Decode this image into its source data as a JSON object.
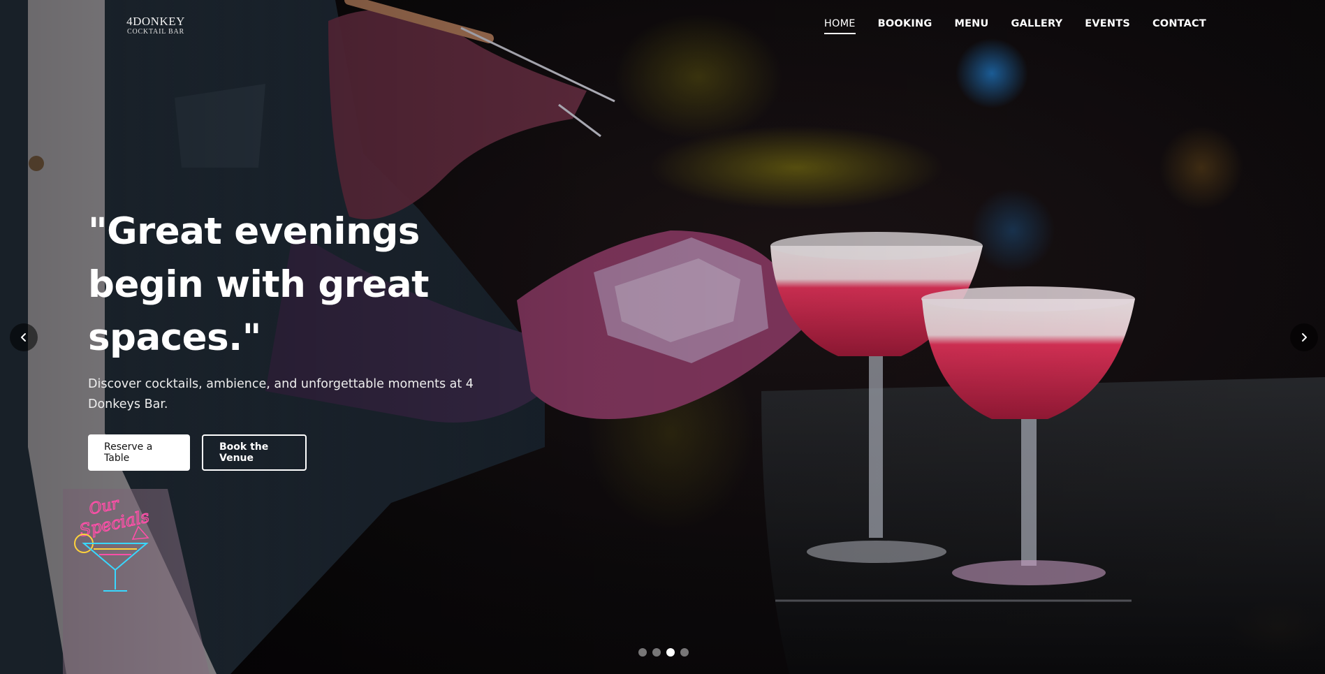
{
  "brand": {
    "name": "4DONKEY",
    "tagline": "COCKTAIL BAR"
  },
  "nav": {
    "items": [
      {
        "label": "HOME",
        "active": true
      },
      {
        "label": "BOOKING",
        "active": false
      },
      {
        "label": "MENU",
        "active": false
      },
      {
        "label": "GALLERY",
        "active": false
      },
      {
        "label": "EVENTS",
        "active": false
      },
      {
        "label": "CONTACT",
        "active": false
      }
    ]
  },
  "hero": {
    "headline": "\"Great evenings begin with great spaces.\"",
    "subtext": "Discover cocktails, ambience, and unforgettable moments at 4 Donkeys Bar.",
    "primary_cta": "Reserve a Table",
    "secondary_cta": "Book the Venue",
    "specials_sign": "Our Specials"
  },
  "carousel": {
    "slide_count": 4,
    "active_index": 2,
    "prev_icon": "chevron-left-icon",
    "next_icon": "chevron-right-icon"
  },
  "colors": {
    "accent_white": "#ffffff",
    "neon_pink": "#ff4fa8",
    "neon_cyan": "#39d8ff",
    "neon_yellow": "#ffd23c",
    "cocktail_red": "#e2335a",
    "bokeh_blue": "#1f6fb5",
    "bokeh_yellow": "#8a7a10"
  }
}
